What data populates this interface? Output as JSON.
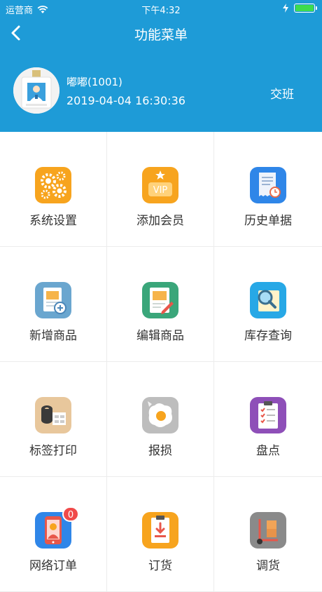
{
  "status_bar": {
    "carrier": "运营商",
    "time": "下午4:32"
  },
  "nav": {
    "title": "功能菜单"
  },
  "user": {
    "name": "嘟嘟(1001)",
    "datetime": "2019-04-04 16:30:36",
    "shift_button": "交班"
  },
  "menu": [
    {
      "label": "系统设置",
      "icon": "gears-icon"
    },
    {
      "label": "添加会员",
      "icon": "vip-icon"
    },
    {
      "label": "历史单据",
      "icon": "history-receipt-icon"
    },
    {
      "label": "新增商品",
      "icon": "add-product-icon"
    },
    {
      "label": "编辑商品",
      "icon": "edit-product-icon"
    },
    {
      "label": "库存查询",
      "icon": "inventory-search-icon"
    },
    {
      "label": "标签打印",
      "icon": "label-roll-icon"
    },
    {
      "label": "报损",
      "icon": "broken-egg-icon"
    },
    {
      "label": "盘点",
      "icon": "checklist-clipboard-icon"
    },
    {
      "label": "网络订单",
      "icon": "online-order-icon",
      "badge": "0"
    },
    {
      "label": "订货",
      "icon": "order-goods-icon"
    },
    {
      "label": "调货",
      "icon": "transfer-goods-icon"
    }
  ],
  "colors": {
    "header": "#1e9bd7",
    "badge": "#f04a4a"
  }
}
